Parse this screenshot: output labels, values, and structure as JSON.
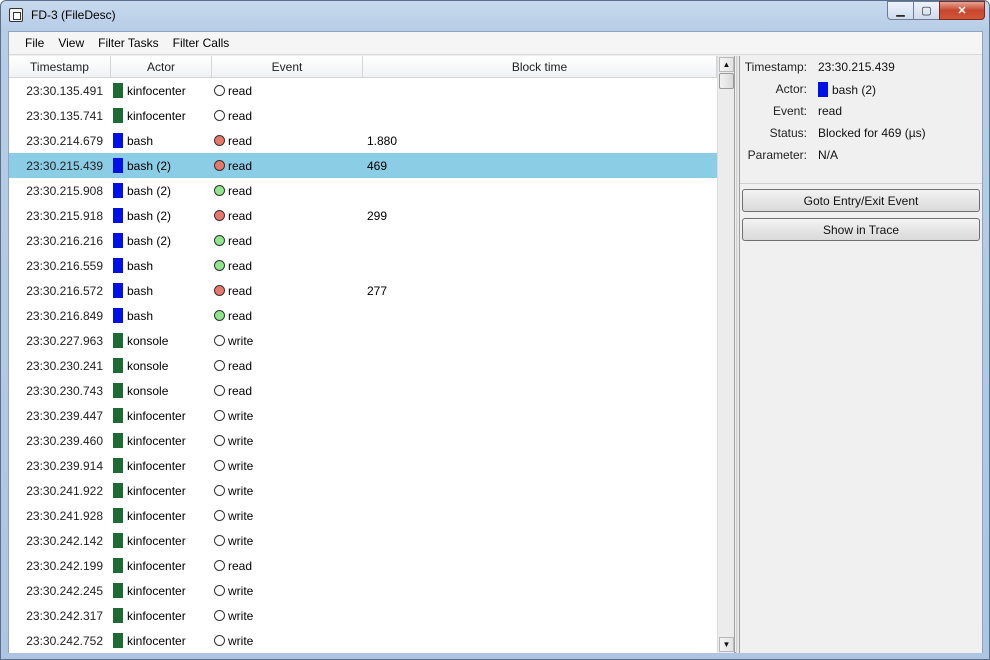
{
  "window": {
    "title": "FD-3 (FileDesc)",
    "minimize": "▁",
    "maximize": "▢",
    "close": "✕"
  },
  "menubar": {
    "items": [
      "File",
      "View",
      "Filter Tasks",
      "Filter Calls"
    ]
  },
  "table": {
    "columns": [
      "Timestamp",
      "Actor",
      "Event",
      "Block time"
    ],
    "selected_row": 3,
    "rows": [
      {
        "timestamp": "23:30.135.491",
        "actor": "kinfocenter",
        "actor_color": "#1d6b33",
        "event": "read",
        "event_state": "none",
        "block_time": ""
      },
      {
        "timestamp": "23:30.135.741",
        "actor": "kinfocenter",
        "actor_color": "#1d6b33",
        "event": "read",
        "event_state": "none",
        "block_time": ""
      },
      {
        "timestamp": "23:30.214.679",
        "actor": "bash",
        "actor_color": "#0010e6",
        "event": "read",
        "event_state": "blocked",
        "block_time": "1.880"
      },
      {
        "timestamp": "23:30.215.439",
        "actor": "bash (2)",
        "actor_color": "#0010e6",
        "event": "read",
        "event_state": "blocked",
        "block_time": "469"
      },
      {
        "timestamp": "23:30.215.908",
        "actor": "bash (2)",
        "actor_color": "#0010e6",
        "event": "read",
        "event_state": "ok",
        "block_time": ""
      },
      {
        "timestamp": "23:30.215.918",
        "actor": "bash (2)",
        "actor_color": "#0010e6",
        "event": "read",
        "event_state": "blocked",
        "block_time": "299"
      },
      {
        "timestamp": "23:30.216.216",
        "actor": "bash (2)",
        "actor_color": "#0010e6",
        "event": "read",
        "event_state": "ok",
        "block_time": ""
      },
      {
        "timestamp": "23:30.216.559",
        "actor": "bash",
        "actor_color": "#0010e6",
        "event": "read",
        "event_state": "ok",
        "block_time": ""
      },
      {
        "timestamp": "23:30.216.572",
        "actor": "bash",
        "actor_color": "#0010e6",
        "event": "read",
        "event_state": "blocked",
        "block_time": "277"
      },
      {
        "timestamp": "23:30.216.849",
        "actor": "bash",
        "actor_color": "#0010e6",
        "event": "read",
        "event_state": "ok",
        "block_time": ""
      },
      {
        "timestamp": "23:30.227.963",
        "actor": "konsole",
        "actor_color": "#1d6b33",
        "event": "write",
        "event_state": "none",
        "block_time": ""
      },
      {
        "timestamp": "23:30.230.241",
        "actor": "konsole",
        "actor_color": "#1d6b33",
        "event": "read",
        "event_state": "none",
        "block_time": ""
      },
      {
        "timestamp": "23:30.230.743",
        "actor": "konsole",
        "actor_color": "#1d6b33",
        "event": "read",
        "event_state": "none",
        "block_time": ""
      },
      {
        "timestamp": "23:30.239.447",
        "actor": "kinfocenter",
        "actor_color": "#1d6b33",
        "event": "write",
        "event_state": "none",
        "block_time": ""
      },
      {
        "timestamp": "23:30.239.460",
        "actor": "kinfocenter",
        "actor_color": "#1d6b33",
        "event": "write",
        "event_state": "none",
        "block_time": ""
      },
      {
        "timestamp": "23:30.239.914",
        "actor": "kinfocenter",
        "actor_color": "#1d6b33",
        "event": "write",
        "event_state": "none",
        "block_time": ""
      },
      {
        "timestamp": "23:30.241.922",
        "actor": "kinfocenter",
        "actor_color": "#1d6b33",
        "event": "write",
        "event_state": "none",
        "block_time": ""
      },
      {
        "timestamp": "23:30.241.928",
        "actor": "kinfocenter",
        "actor_color": "#1d6b33",
        "event": "write",
        "event_state": "none",
        "block_time": ""
      },
      {
        "timestamp": "23:30.242.142",
        "actor": "kinfocenter",
        "actor_color": "#1d6b33",
        "event": "write",
        "event_state": "none",
        "block_time": ""
      },
      {
        "timestamp": "23:30.242.199",
        "actor": "kinfocenter",
        "actor_color": "#1d6b33",
        "event": "read",
        "event_state": "none",
        "block_time": ""
      },
      {
        "timestamp": "23:30.242.245",
        "actor": "kinfocenter",
        "actor_color": "#1d6b33",
        "event": "write",
        "event_state": "none",
        "block_time": ""
      },
      {
        "timestamp": "23:30.242.317",
        "actor": "kinfocenter",
        "actor_color": "#1d6b33",
        "event": "write",
        "event_state": "none",
        "block_time": ""
      },
      {
        "timestamp": "23:30.242.752",
        "actor": "kinfocenter",
        "actor_color": "#1d6b33",
        "event": "write",
        "event_state": "none",
        "block_time": ""
      }
    ]
  },
  "event_state_colors": {
    "none": "#ffffff",
    "blocked": "#e8776a",
    "ok": "#8ee58a"
  },
  "details": {
    "timestamp_label": "Timestamp:",
    "timestamp_value": "23:30.215.439",
    "actor_label": "Actor:",
    "actor_value": "bash (2)",
    "actor_color": "#0010e6",
    "event_label": "Event:",
    "event_value": "read",
    "status_label": "Status:",
    "status_value": "Blocked for 469 (µs)",
    "parameter_label": "Parameter:",
    "parameter_value": "N/A"
  },
  "buttons": {
    "goto": "Goto Entry/Exit Event",
    "show_in_trace": "Show in Trace"
  },
  "scrollbar": {
    "up": "▲",
    "down": "▼"
  }
}
